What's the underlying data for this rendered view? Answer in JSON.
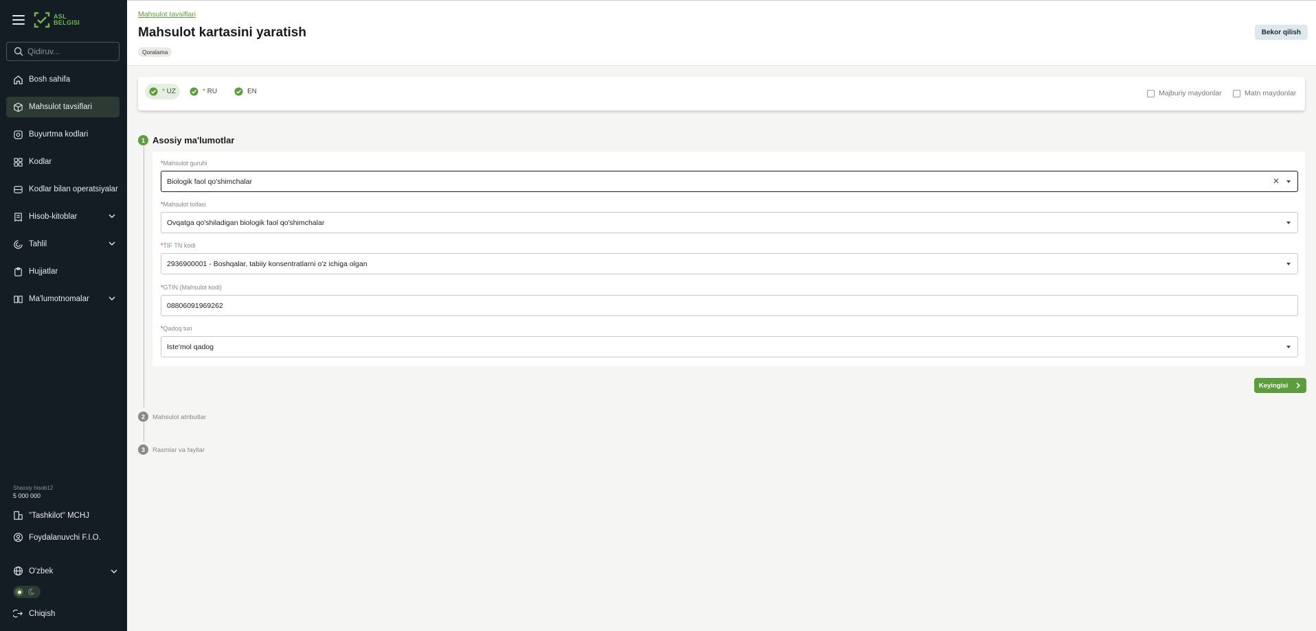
{
  "app": {
    "logo_text_1": "ASL",
    "logo_text_2": "BELGISI"
  },
  "sidebar": {
    "search_placeholder": "Qidiruv...",
    "items": [
      {
        "label": "Bosh sahifa",
        "icon": "home-icon"
      },
      {
        "label": "Mahsulot tavsiflari",
        "icon": "cube-icon",
        "active": true
      },
      {
        "label": "Buyurtma kodlari",
        "icon": "order-codes-icon"
      },
      {
        "label": "Kodlar",
        "icon": "qr-codes-icon"
      },
      {
        "label": "Kodlar bilan operatsiyalar",
        "icon": "operations-icon"
      },
      {
        "label": "Hisob-kitoblar",
        "icon": "receipt-icon",
        "expandable": true
      },
      {
        "label": "Tahlil",
        "icon": "analytics-icon",
        "expandable": true
      },
      {
        "label": "Hujjatlar",
        "icon": "clipboard-icon"
      },
      {
        "label": "Ma'lumotnomalar",
        "icon": "book-icon",
        "expandable": true
      }
    ],
    "account_label": "Shaxsiy hisob12",
    "account_value": "5 000 000",
    "organization": "\"Tashkilot\" MCHJ",
    "user": "Foydalanuvchi F.I.O.",
    "language": "O'zbek",
    "logout": "Chiqish"
  },
  "header": {
    "breadcrumb": "Mahsulot tavsiflari",
    "title": "Mahsulot kartasini yaratish",
    "status_badge": "Qoralama",
    "cancel_label": "Bekor qilish"
  },
  "languages": {
    "tabs": [
      {
        "code": "UZ",
        "required": true,
        "active": true
      },
      {
        "code": "RU",
        "required": true,
        "active": false
      },
      {
        "code": "EN",
        "required": false,
        "active": false
      }
    ],
    "checkbox_required": "Majburiy maydonlar",
    "checkbox_text": "Matn maydonlar"
  },
  "steps": [
    {
      "number": "1",
      "title": "Asosiy ma'lumotlar"
    },
    {
      "number": "2",
      "title": "Mahsulot atributlar"
    },
    {
      "number": "3",
      "title": "Rasmlar va fayllar"
    }
  ],
  "form": {
    "fields": [
      {
        "label": "Mahsulot guruhi",
        "value": "Biologik faol qo'shimchalar",
        "type": "select"
      },
      {
        "label": "Mahsulot toifasi",
        "value": "Ovqatga qo'shiladigan biologik faol qo'shimchalar",
        "type": "select"
      },
      {
        "label": "TIF TN kodi",
        "value": "2936900001 - Boshqalar, tabiiy konsentratlarni o'z ichiga olgan",
        "type": "select"
      },
      {
        "label": "GTIN (Mahsulot kodi)",
        "value": "08806091969262",
        "type": "text"
      },
      {
        "label": "Qadoq turi",
        "value": "Iste'mol qadog",
        "type": "select"
      }
    ],
    "next_label": "Keyingisi"
  },
  "colors": {
    "accent": "#5d9c3f",
    "sidebar_bg": "#141d24",
    "required_star": "#d9342b"
  }
}
